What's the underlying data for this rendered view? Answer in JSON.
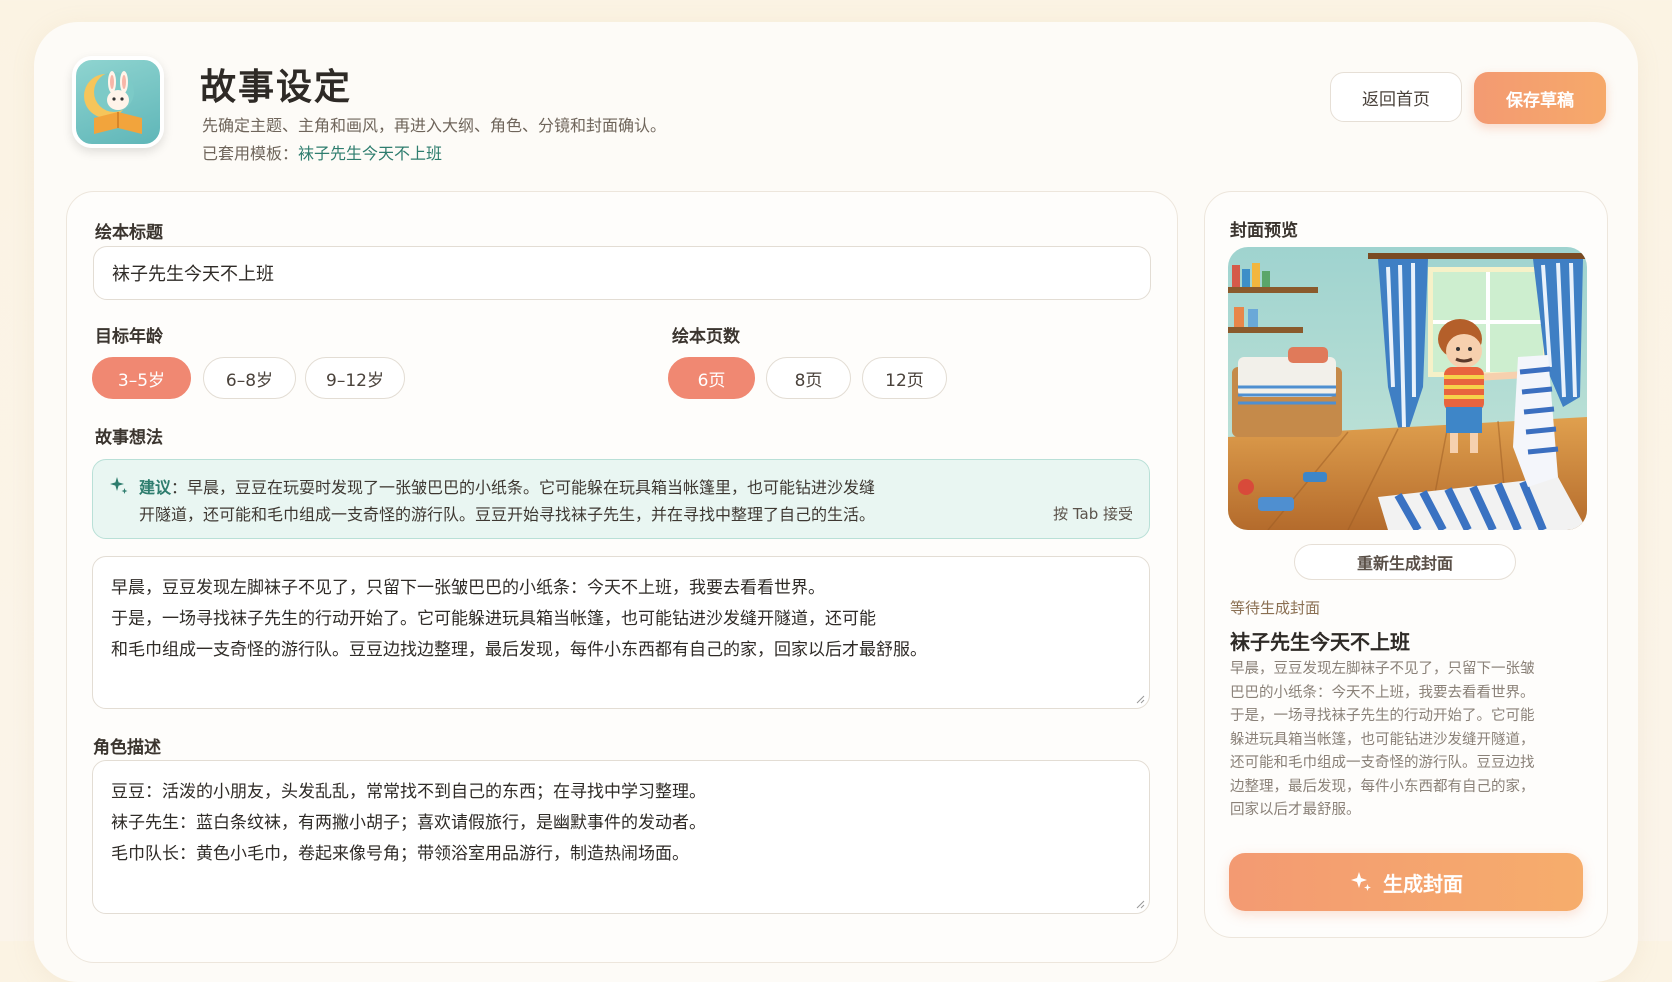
{
  "header": {
    "title": "故事设定",
    "subtitle": "先确定主题、主角和画风，再进入大纲、角色、分镜和封面确认。",
    "template_prefix": "已套用模板：",
    "template_name": "袜子先生今天不上班",
    "home_button": "返回首页",
    "save_button": "保存草稿"
  },
  "form": {
    "title_label": "绘本标题",
    "title_value": "袜子先生今天不上班",
    "age_label": "目标年龄",
    "age_options": [
      "3–5岁",
      "6–8岁",
      "9–12岁"
    ],
    "age_selected": "3–5岁",
    "pages_label": "绘本页数",
    "page_options": [
      "6页",
      "8页",
      "12页"
    ],
    "pages_selected": "6页",
    "idea_label": "故事想法",
    "suggestion": {
      "prefix": "建议",
      "line1": "：早晨，豆豆在玩耍时发现了一张皱巴巴的小纸条。它可能躲在玩具箱当帐篷里，也可能钻进沙发缝",
      "line2": "开隧道，还可能和毛巾组成一支奇怪的游行队。豆豆开始寻找袜子先生，并在寻找中整理了自己的生活。",
      "hint": "按 Tab 接受"
    },
    "idea_lines": [
      "早晨，豆豆发现左脚袜子不见了，只留下一张皱巴巴的小纸条：今天不上班，我要去看看世界。",
      "于是，一场寻找袜子先生的行动开始了。它可能躲进玩具箱当帐篷，也可能钻进沙发缝开隧道，还可能",
      "和毛巾组成一支奇怪的游行队。豆豆边找边整理，最后发现，每件小东西都有自己的家，回家以后才最舒服。"
    ],
    "character_label": "角色描述",
    "character_lines": [
      "豆豆：活泼的小朋友，头发乱乱，常常找不到自己的东西；在寻找中学习整理。",
      "袜子先生：蓝白条纹袜，有两撇小胡子；喜欢请假旅行，是幽默事件的发动者。",
      "毛巾队长：黄色小毛巾，卷起来像号角；带领浴室用品游行，制造热闹场面。"
    ]
  },
  "preview": {
    "label": "封面预览",
    "regen_button": "重新生成封面",
    "status": "等待生成封面",
    "title": "袜子先生今天不上班",
    "description": "早晨，豆豆发现左脚袜子不见了，只留下一张皱巴巴的小纸条：今天不上班，我要去看看世界。于是，一场寻找袜子先生的行动开始了。它可能躲进玩具箱当帐篷，也可能钻进沙发缝开隧道，还可能和毛巾组成一支奇怪的游行队。豆豆边找边整理，最后发现，每件小东西都有自己的家，回家以后才最舒服。",
    "generate_button": "生成封面"
  },
  "colors": {
    "accent": "#f08872",
    "teal": "#2e7d6e",
    "suggestion_bg": "#e9f6f2"
  },
  "icons": [
    "bunny-book-logo",
    "sparkle-icon"
  ]
}
